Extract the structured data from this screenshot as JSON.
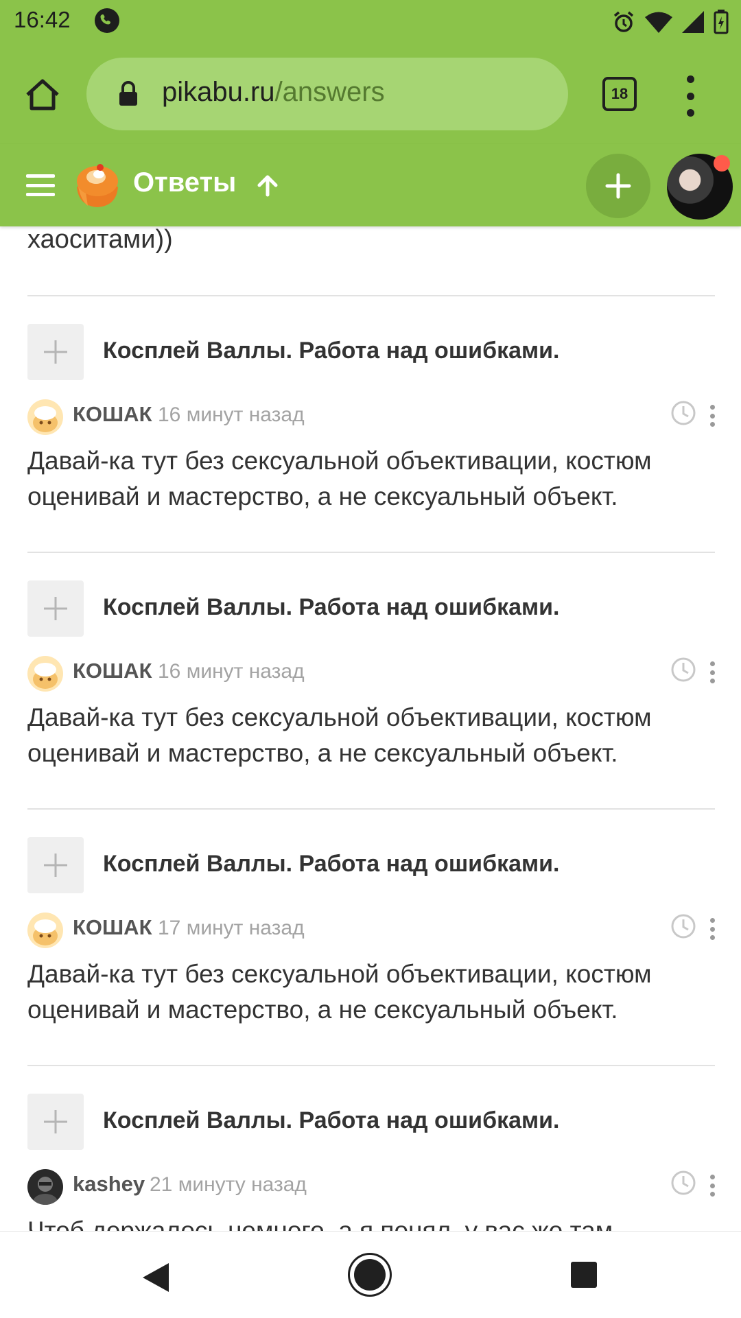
{
  "status_bar": {
    "time": "16:42"
  },
  "browser": {
    "url_host": "pikabu.ru",
    "url_path": "/answers",
    "tab_count": "18"
  },
  "header": {
    "title": "Ответы"
  },
  "content": {
    "partial_top_text": "хаоситами))",
    "items": [
      {
        "title": "Косплей Валлы. Работа над ошибками.",
        "user": "КОШАК",
        "time": "16 минут назад",
        "comment": "Давай-ка тут без сексуальной объективации, костюм оценивай и мастерство, а не сексуальный объект."
      },
      {
        "title": "Косплей Валлы. Работа над ошибками.",
        "user": "КОШАК",
        "time": "16 минут назад",
        "comment": "Давай-ка тут без сексуальной объективации, костюм оценивай и мастерство, а не сексуальный объект."
      },
      {
        "title": "Косплей Валлы. Работа над ошибками.",
        "user": "КОШАК",
        "time": "17 минут назад",
        "comment": "Давай-ка тут без сексуальной объективации, костюм оценивай и мастерство, а не сексуальный объект."
      },
      {
        "title": "Косплей Валлы. Работа над ошибками.",
        "user": "kashey",
        "time": "21 минуту назад",
        "comment": "Чтоб держалось немного, а я понял, у вас же там"
      }
    ]
  },
  "colors": {
    "accent_green": "#8bc34a",
    "add_button": "#79ad3e",
    "notification_dot": "#ff5b4a"
  },
  "icons": [
    "phone-icon",
    "alarm-icon",
    "wifi-icon",
    "signal-icon",
    "battery-icon",
    "home-icon",
    "lock-icon",
    "more-icon",
    "menu-icon",
    "pikabu-logo",
    "up-arrow-icon",
    "plus-icon",
    "clock-icon"
  ]
}
